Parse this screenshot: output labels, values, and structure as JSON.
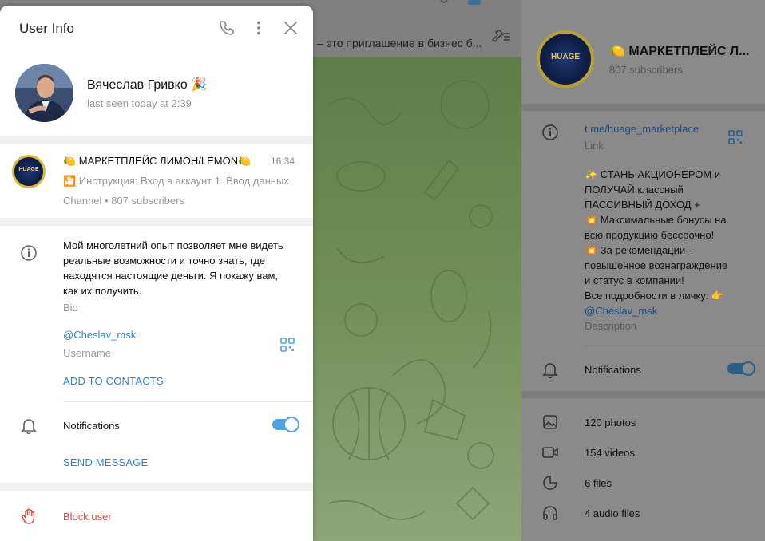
{
  "dialog": {
    "title": "User Info",
    "user": {
      "name": "Вячеслав Гривко 🎉",
      "status": "last seen today at 2:39"
    },
    "chat": {
      "name": "🍋 МАРКЕТПЛЕЙС ЛИМОН/LEMON🍋",
      "time": "16:34",
      "preview": "🎦 Инструкция: Вход в аккаунт  1.  Ввод данных",
      "meta": "Channel • 807 subscribers",
      "avatar_text": "HUAGE"
    },
    "bio": {
      "text": "Мой многолетний опыт позволяет мне видеть реальные возможности и точно знать, где находятся настоящие деньги. Я покажу вам, как их получить.",
      "label": "Bio"
    },
    "username": {
      "value": "@Cheslav_msk",
      "label": "Username"
    },
    "add_contacts": "ADD TO CONTACTS",
    "notifications": {
      "label": "Notifications",
      "enabled": true
    },
    "send_message": "SEND MESSAGE",
    "block_user": "Block user"
  },
  "background": {
    "pinned_text": "– это приглашение в бизнес б..."
  },
  "channel": {
    "title": "🍋 МАРКЕТПЛЕЙС Л...",
    "subscribers": "807 subscribers",
    "avatar_text": "HUAGE",
    "link": {
      "value": "t.me/huage_marketplace",
      "label": "Link"
    },
    "description": {
      "lines": [
        "✨ СТАНЬ АКЦИОНЕРОМ и",
        "ПОЛУЧАЙ классный",
        "ПАССИВНЫЙ ДОХОД +",
        "💥 Максимальные бонусы на",
        "всю продукцию бессрочно!",
        "💥 За рекомендации -",
        "повышенное вознаграждение",
        "и статус в компании!",
        "Все подробности в личку: 👉"
      ],
      "mention": "@Cheslav_msk",
      "label": "Description"
    },
    "notifications": {
      "label": "Notifications",
      "enabled": true
    },
    "media": [
      {
        "label": "120 photos"
      },
      {
        "label": "154 videos"
      },
      {
        "label": "6 files"
      },
      {
        "label": "4 audio files"
      }
    ]
  },
  "colors": {
    "accent": "#2b84c7",
    "danger": "#d9463b",
    "toggle": "#4ba3e2"
  }
}
